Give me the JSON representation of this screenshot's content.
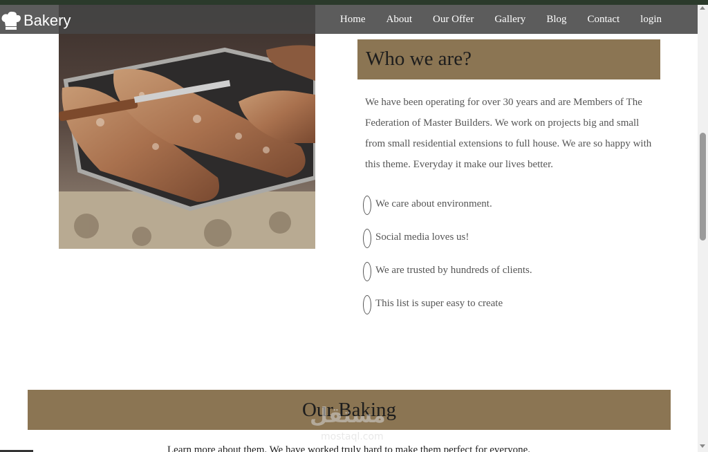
{
  "brand": {
    "name": "Bakery",
    "icon": "chef-hat-icon"
  },
  "nav": {
    "items": [
      "Home",
      "About",
      "Our Offer",
      "Gallery",
      "Blog",
      "Contact",
      "login"
    ]
  },
  "about": {
    "title": "Who we are?",
    "body": "We have been operating for over 30 years and are Members of The Federation of Master Builders. We work on projects big and small from small residential extensions to full house. We are so happy with this theme. Everyday it make our lives better.",
    "features": [
      "We care about environment.",
      "Social media loves us!",
      "We are trusted by hundreds of clients.",
      "This list is super easy to create"
    ]
  },
  "baking": {
    "title": "Our Baking",
    "subtitle": "Learn more about them. We have worked truly hard to make them perfect for everyone."
  },
  "watermark": {
    "arabic": "مستقل",
    "latin": "mostaql.com"
  },
  "colors": {
    "accent": "#8b7553",
    "nav_bg": "#464646"
  }
}
